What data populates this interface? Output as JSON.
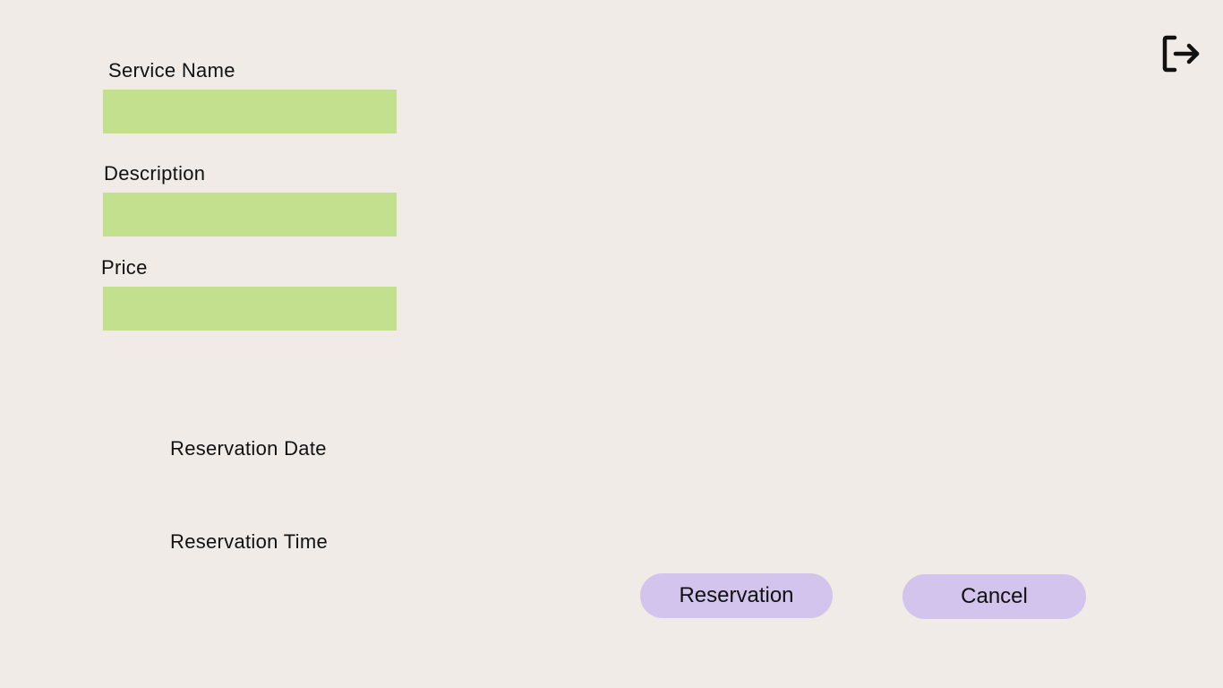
{
  "colors": {
    "background": "#f0ebe6",
    "field_fill": "#c2e08e",
    "button_fill": "#d2c4ec",
    "text": "#111111"
  },
  "form": {
    "service_name": {
      "label": "Service Name",
      "value": ""
    },
    "description": {
      "label": "Description",
      "value": ""
    },
    "price": {
      "label": "Price",
      "value": ""
    },
    "reservation_date": {
      "label": "Reservation Date"
    },
    "reservation_time": {
      "label": "Reservation Time"
    }
  },
  "actions": {
    "reservation_label": "Reservation",
    "cancel_label": "Cancel"
  },
  "header": {
    "logout_icon": "logout-icon"
  }
}
